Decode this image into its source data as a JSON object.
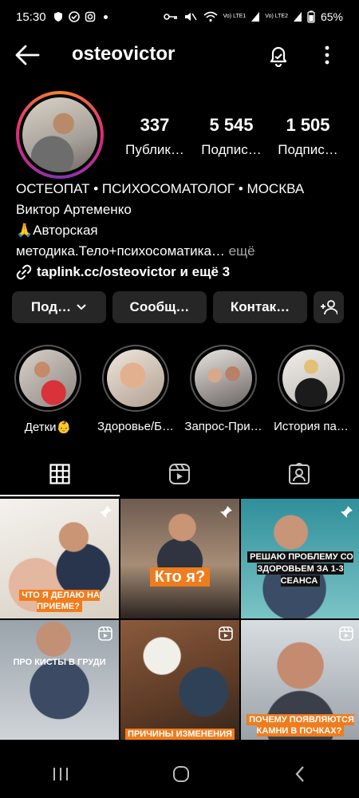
{
  "status": {
    "time": "15:30",
    "battery": "65%",
    "lte1": "Vo) LTE1",
    "lte2": "Vo) LTE2"
  },
  "header": {
    "username": "osteovictor"
  },
  "stats": [
    {
      "value": "337",
      "label": "Публик…"
    },
    {
      "value": "5 545",
      "label": "Подпис…"
    },
    {
      "value": "1 505",
      "label": "Подпис…"
    }
  ],
  "bio": {
    "title": "ОСТЕОПАТ • ПСИХОСОМАТОЛОГ • МОСКВА",
    "name": "Виктор Артеменко",
    "line1": "🙏Авторская",
    "line2": "методика.Тело+психосоматика…",
    "more": "ещё",
    "link": "taplink.cc/osteovictor и ещё 3"
  },
  "buttons": {
    "subscribe": "Под…",
    "message": "Сообщ…",
    "contact": "Контак…"
  },
  "highlights": [
    {
      "label": "Детки👶"
    },
    {
      "label": "Здоровье/Б…"
    },
    {
      "label": "Запрос-При…"
    },
    {
      "label": "История па…"
    }
  ],
  "posts": [
    {
      "caption": "ЧТО Я ДЕЛАЮ НА ПРИЕМЕ?",
      "badge": "pin"
    },
    {
      "caption": "Кто я?",
      "badge": "pin"
    },
    {
      "caption": "РЕШАЮ ПРОБЛЕМУ СО ЗДОРОВЬЕМ ЗА 1-3 СЕАНСА",
      "badge": "pin"
    },
    {
      "caption": "ПРО КИСТЫ В ГРУДИ",
      "badge": "reel"
    },
    {
      "caption": "ПРИЧИНЫ ИЗМЕНЕНИЯ",
      "badge": "reel"
    },
    {
      "caption": "ПОЧЕМУ ПОЯВЛЯЮТСЯ КАМНИ В ПОЧКАХ?",
      "badge": "reel"
    }
  ],
  "colors": {
    "button_bg": "#262626",
    "accent_orange": "#f07c1d",
    "muted": "#a8a8a8"
  }
}
